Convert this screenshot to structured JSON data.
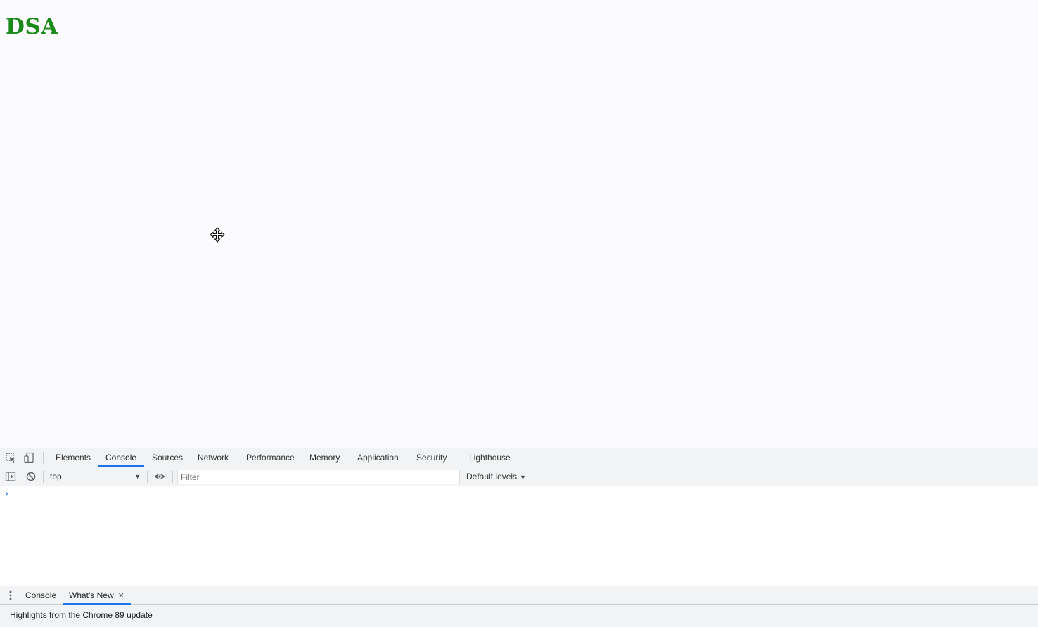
{
  "page": {
    "heading": "DSA",
    "heading_color": "#1a8a1a"
  },
  "cursor": {
    "icon": "move-cursor-icon"
  },
  "devtools": {
    "tools": [
      {
        "icon": "inspect-element-icon"
      },
      {
        "icon": "device-toolbar-icon"
      }
    ],
    "tabs": [
      {
        "label": "Elements"
      },
      {
        "label": "Console",
        "active": true
      },
      {
        "label": "Sources"
      },
      {
        "label": "Network"
      },
      {
        "label": "Performance"
      },
      {
        "label": "Memory"
      },
      {
        "label": "Application"
      },
      {
        "label": "Security"
      },
      {
        "label": "Lighthouse"
      }
    ],
    "toolbar": {
      "sidebar_icon": "show-sidebar-icon",
      "clear_icon": "clear-console-icon",
      "context": "top",
      "eye_icon": "live-expression-eye-icon",
      "filter_placeholder": "Filter",
      "filter_value": "",
      "levels": "Default levels"
    },
    "console": {
      "prompt": "›"
    },
    "drawer": {
      "menu_icon": "more-vert-icon",
      "tabs": [
        {
          "label": "Console"
        },
        {
          "label": "What's New",
          "active": true,
          "close": "✕"
        }
      ],
      "content": "Highlights from the Chrome 89 update"
    },
    "accent_color": "#1a73e8"
  }
}
